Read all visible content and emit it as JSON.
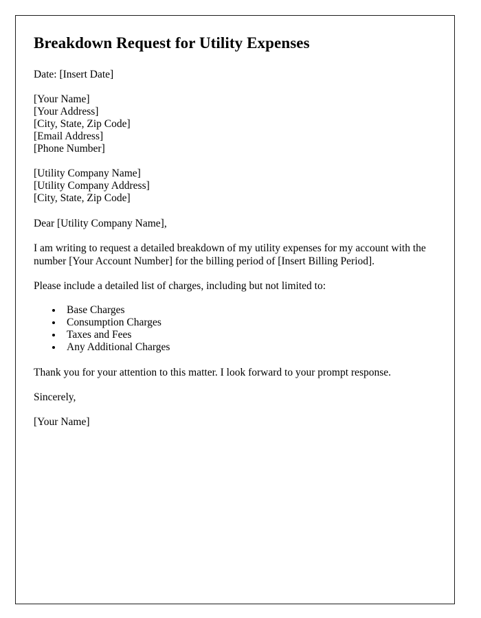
{
  "document": {
    "title": "Breakdown Request for Utility Expenses",
    "date_line": "Date: [Insert Date]",
    "sender_block": [
      "[Your Name]",
      "[Your Address]",
      "[City, State, Zip Code]",
      "[Email Address]",
      "[Phone Number]"
    ],
    "recipient_block": [
      "[Utility Company Name]",
      "[Utility Company Address]",
      "[City, State, Zip Code]"
    ],
    "salutation": "Dear [Utility Company Name],",
    "body_paragraph": "I am writing to request a detailed breakdown of my utility expenses for my account with the number [Your Account Number] for the billing period of [Insert Billing Period].",
    "list_intro": "Please include a detailed list of charges, including but not limited to:",
    "charge_items": [
      "Base Charges",
      "Consumption Charges",
      "Taxes and Fees",
      "Any Additional Charges"
    ],
    "closing_paragraph": "Thank you for your attention to this matter. I look forward to your prompt response.",
    "closing_valediction": "Sincerely,",
    "signature_name": "[Your Name]"
  }
}
